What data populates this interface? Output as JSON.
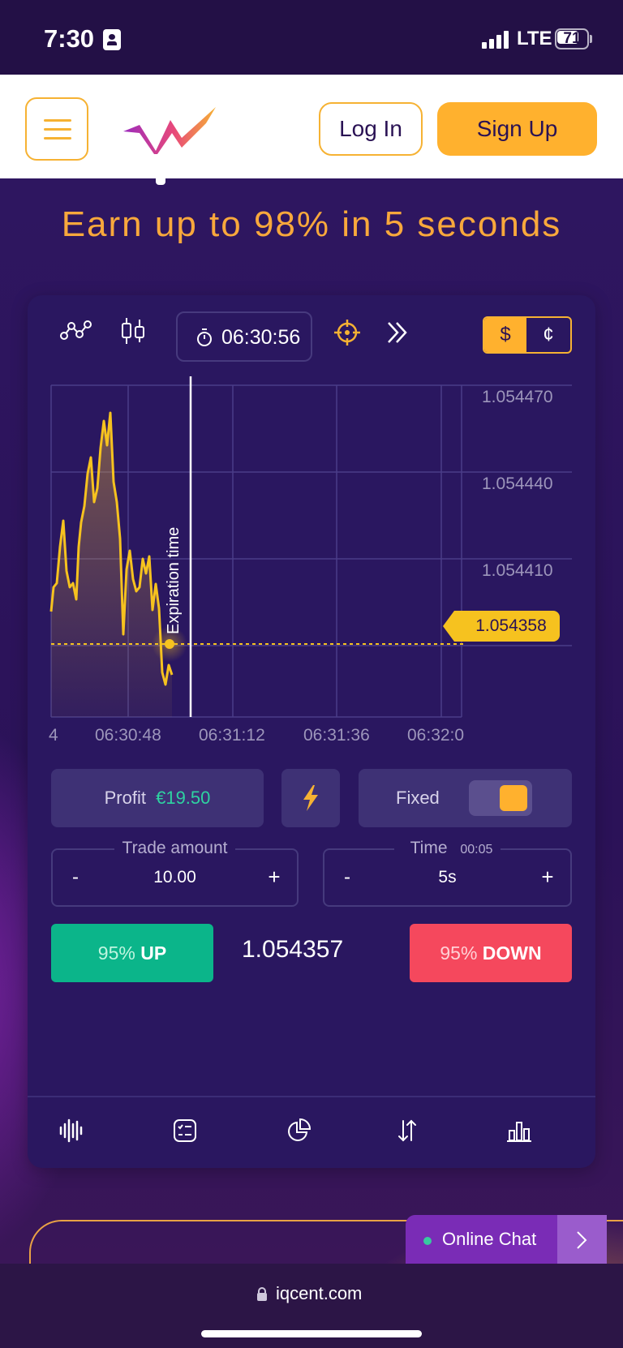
{
  "status_bar": {
    "time": "7:30",
    "network": "LTE",
    "battery": "71"
  },
  "header": {
    "login_label": "Log In",
    "signup_label": "Sign Up",
    "brand_color": "#ffb12e"
  },
  "hero": {
    "headline": "Earn up to 98% in 5 seconds"
  },
  "trade": {
    "timer": "06:30:56",
    "currency_options": [
      "$",
      "¢"
    ],
    "selected_currency": "$",
    "chart": {
      "y_ticks": [
        "1.054470",
        "1.054440",
        "1.054410"
      ],
      "x_ticks": [
        "4",
        "06:30:48",
        "06:31:12",
        "06:31:36",
        "06:32:0"
      ],
      "expiration_label": "Expiration time",
      "current_price_tag": "1.054358",
      "line_color": "#f6c21f"
    },
    "profit_label": "Profit",
    "profit_value": "€19.50",
    "fixed_label": "Fixed",
    "fixed_toggle_on": true,
    "amount": {
      "label": "Trade amount",
      "value": "10.00",
      "minus": "-",
      "plus": "+"
    },
    "time": {
      "label": "Time",
      "sub": "00:05",
      "value": "5s",
      "minus": "-",
      "plus": "+"
    },
    "up_button": {
      "pct": "95%",
      "dir": "UP",
      "color": "#0bb58a"
    },
    "current_price": "1.054357",
    "down_button": {
      "pct": "95%",
      "dir": "DOWN",
      "color": "#f5485d"
    }
  },
  "chat": {
    "label": "Online Chat"
  },
  "browser": {
    "url": "iqcent.com"
  }
}
